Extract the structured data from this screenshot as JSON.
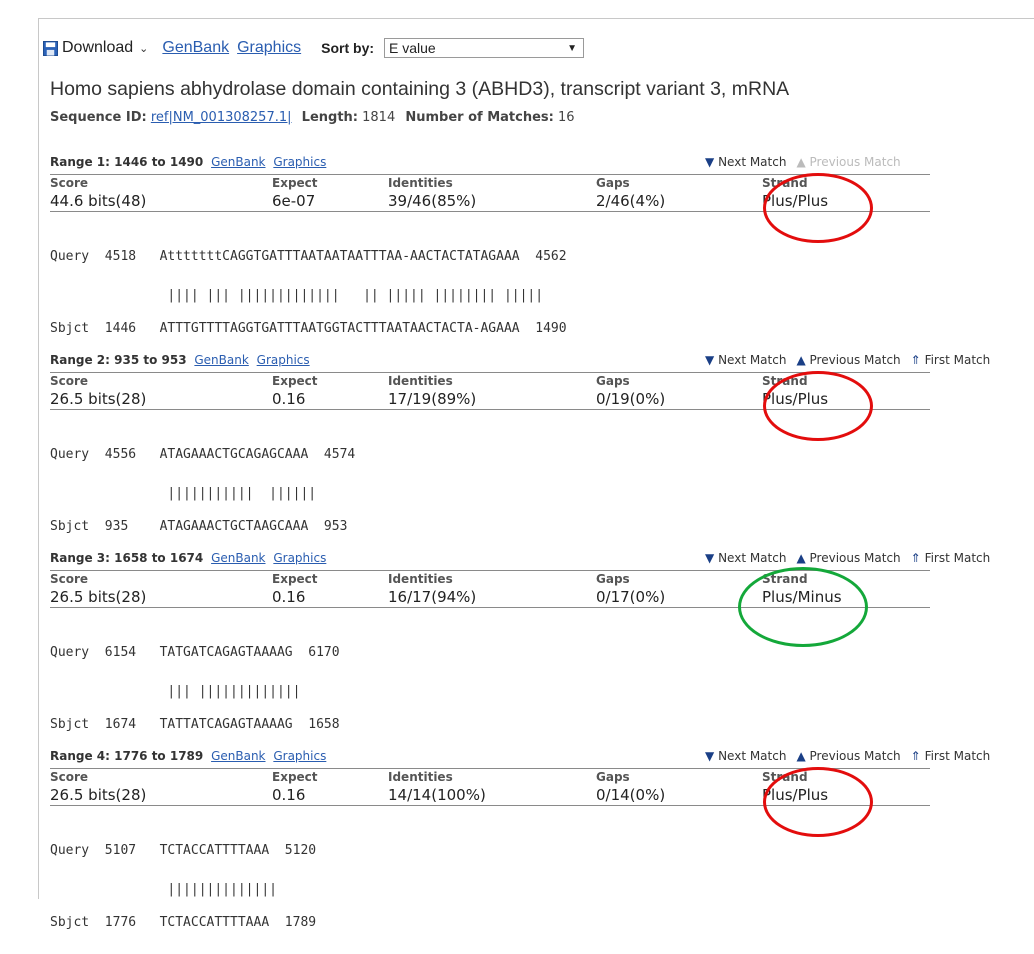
{
  "toolbar": {
    "download_label": "Download",
    "genbank_label": "GenBank",
    "graphics_label": "Graphics",
    "sort_label": "Sort by:",
    "sort_value": "E value"
  },
  "record": {
    "title": "Homo sapiens abhydrolase domain containing 3 (ABHD3), transcript variant 3, mRNA",
    "seq_id_label": "Sequence ID:",
    "seq_id": "ref|NM_001308257.1|",
    "length_label": "Length:",
    "length": "1814",
    "matches_label": "Number of Matches:",
    "matches": "16"
  },
  "columns": {
    "score": "Score",
    "expect": "Expect",
    "identities": "Identities",
    "gaps": "Gaps",
    "strand": "Strand"
  },
  "nav": {
    "next": "Next Match",
    "previous": "Previous Match",
    "first": "First Match"
  },
  "link_genbank": "GenBank",
  "link_graphics": "Graphics",
  "ranges": [
    {
      "title": "Range 1: 1446 to 1490",
      "score": "44.6 bits(48)",
      "expect": "6e-07",
      "identities": "39/46(85%)",
      "gaps": "2/46(4%)",
      "strand": "Plus/Plus",
      "query": "Query  4518   AtttttttCAGGTGATTTAATAATAATTTAA-AACTACTATAGAAA  4562",
      "midline": "               |||| ||| |||||||||||||   || ||||| |||||||| |||||",
      "subject": "Sbjct  1446   ATTTGTTTTAGGTGATTTAATGGTACTTTAATAACTACTA-AGAAA  1490"
    },
    {
      "title": "Range 2: 935 to 953",
      "score": "26.5 bits(28)",
      "expect": "0.16",
      "identities": "17/19(89%)",
      "gaps": "0/19(0%)",
      "strand": "Plus/Plus",
      "query": "Query  4556   ATAGAAACTGCAGAGCAAA  4574",
      "midline": "               |||||||||||  ||||||",
      "subject": "Sbjct  935    ATAGAAACTGCTAAGCAAA  953"
    },
    {
      "title": "Range 3: 1658 to 1674",
      "score": "26.5 bits(28)",
      "expect": "0.16",
      "identities": "16/17(94%)",
      "gaps": "0/17(0%)",
      "strand": "Plus/Minus",
      "query": "Query  6154   TATGATCAGAGTAAAAG  6170",
      "midline": "               ||| |||||||||||||",
      "subject": "Sbjct  1674   TATTATCAGAGTAAAAG  1658"
    },
    {
      "title": "Range 4: 1776 to 1789",
      "score": "26.5 bits(28)",
      "expect": "0.16",
      "identities": "14/14(100%)",
      "gaps": "0/14(0%)",
      "strand": "Plus/Plus",
      "query": "Query  5107   TCTACCATTTTAAA  5120",
      "midline": "               ||||||||||||||",
      "subject": "Sbjct  1776   TCTACCATTTTAAA  1789"
    }
  ],
  "annotation_colors": {
    "plus_plus": "#e30d0d",
    "plus_minus": "#14a83a"
  }
}
